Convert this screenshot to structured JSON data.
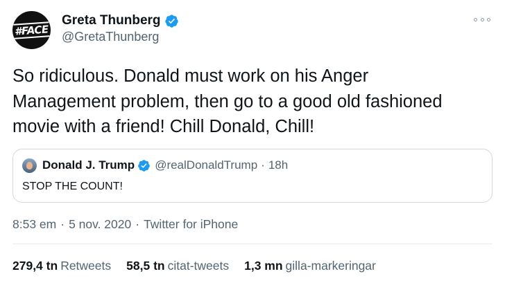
{
  "tweet": {
    "author": {
      "display_name": "Greta Thunberg",
      "handle": "@GretaThunberg",
      "avatar_text": "#FACE",
      "verified": true,
      "verified_icon": "verified-badge-icon"
    },
    "text_lines": [
      "So ridiculous. Donald must work on his Anger",
      "Management problem, then go to a good old fashioned",
      "movie with a friend! Chill Donald, Chill!"
    ],
    "more_icon": "more-options-icon",
    "quoted": {
      "display_name": "Donald J. Trump",
      "handle": "@realDonaldTrump",
      "separator": "·",
      "time": "18h",
      "text": "STOP THE COUNT!",
      "verified": true
    },
    "meta": {
      "time": "8:53 em",
      "separator": "·",
      "date": "5 nov. 2020",
      "source": "Twitter for iPhone"
    },
    "stats": [
      {
        "value": "279,4 tn",
        "label": "Retweets"
      },
      {
        "value": "58,5 tn",
        "label": "citat-tweets"
      },
      {
        "value": "1,3 mn",
        "label": "gilla-markeringar"
      }
    ]
  },
  "colors": {
    "text": "#0f1419",
    "secondary": "#536471",
    "verified": "#1d9bf0",
    "border": "#cfd9de"
  }
}
